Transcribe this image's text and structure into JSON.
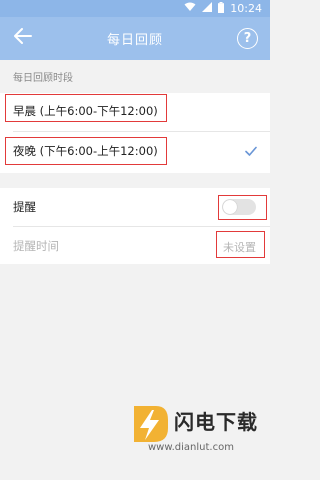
{
  "status_bar": {
    "time": "10:24",
    "icons": [
      "wifi-icon",
      "signal-icon",
      "battery-icon"
    ]
  },
  "app_bar": {
    "title": "每日回顾",
    "back_icon": "arrow-left-icon",
    "help_icon": "help-icon",
    "help_glyph": "?"
  },
  "section": {
    "label": "每日回顾时段"
  },
  "periods": [
    {
      "label": "早晨 (上午6:00-下午12:00)",
      "selected": false
    },
    {
      "label": "夜晚 (下午6:00-上午12:00)",
      "selected": true
    }
  ],
  "reminder": {
    "label": "提醒",
    "enabled": false,
    "time_label": "提醒时间",
    "time_value": "未设置"
  },
  "watermark": {
    "title": "闪电下载",
    "url": "www.dianlut.com"
  },
  "colors": {
    "accent": "#9cc0ec",
    "status_bar": "#8db6e8",
    "highlight": "#e23a3a",
    "check": "#6a96d6"
  }
}
